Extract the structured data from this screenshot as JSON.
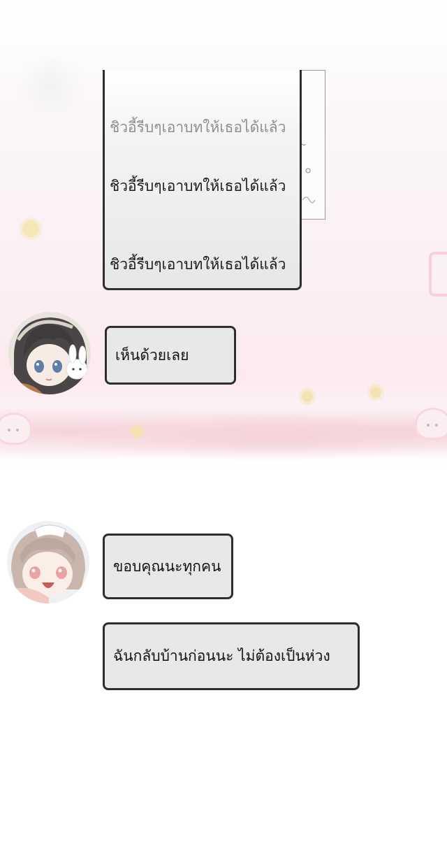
{
  "chat": {
    "top_stack": [
      "ชิวอี้รีบๆเอาบทให้เธอได้แล้ว",
      "ชิวอี้รีบๆเอาบทให้เธอได้แล้ว",
      "ชิวอี้รีบๆเอาบทให้เธอได้แล้ว"
    ],
    "messages": [
      {
        "sender_avatar": "dark-haired-girl-with-bunny",
        "text": "เห็นด้วยเลย"
      },
      {
        "sender_avatar": "light-haired-girl-smiling",
        "text": "ขอบคุณนะทุกคน"
      },
      {
        "sender_avatar": "",
        "text": "ฉันกลับบ้านก่อนนะ ไม่ต้องเป็นห่วง"
      }
    ]
  },
  "colors": {
    "bubble_fill": "#e8e8e8",
    "bubble_border": "#2e2e2e",
    "background_pink": "#fbe9ee"
  }
}
